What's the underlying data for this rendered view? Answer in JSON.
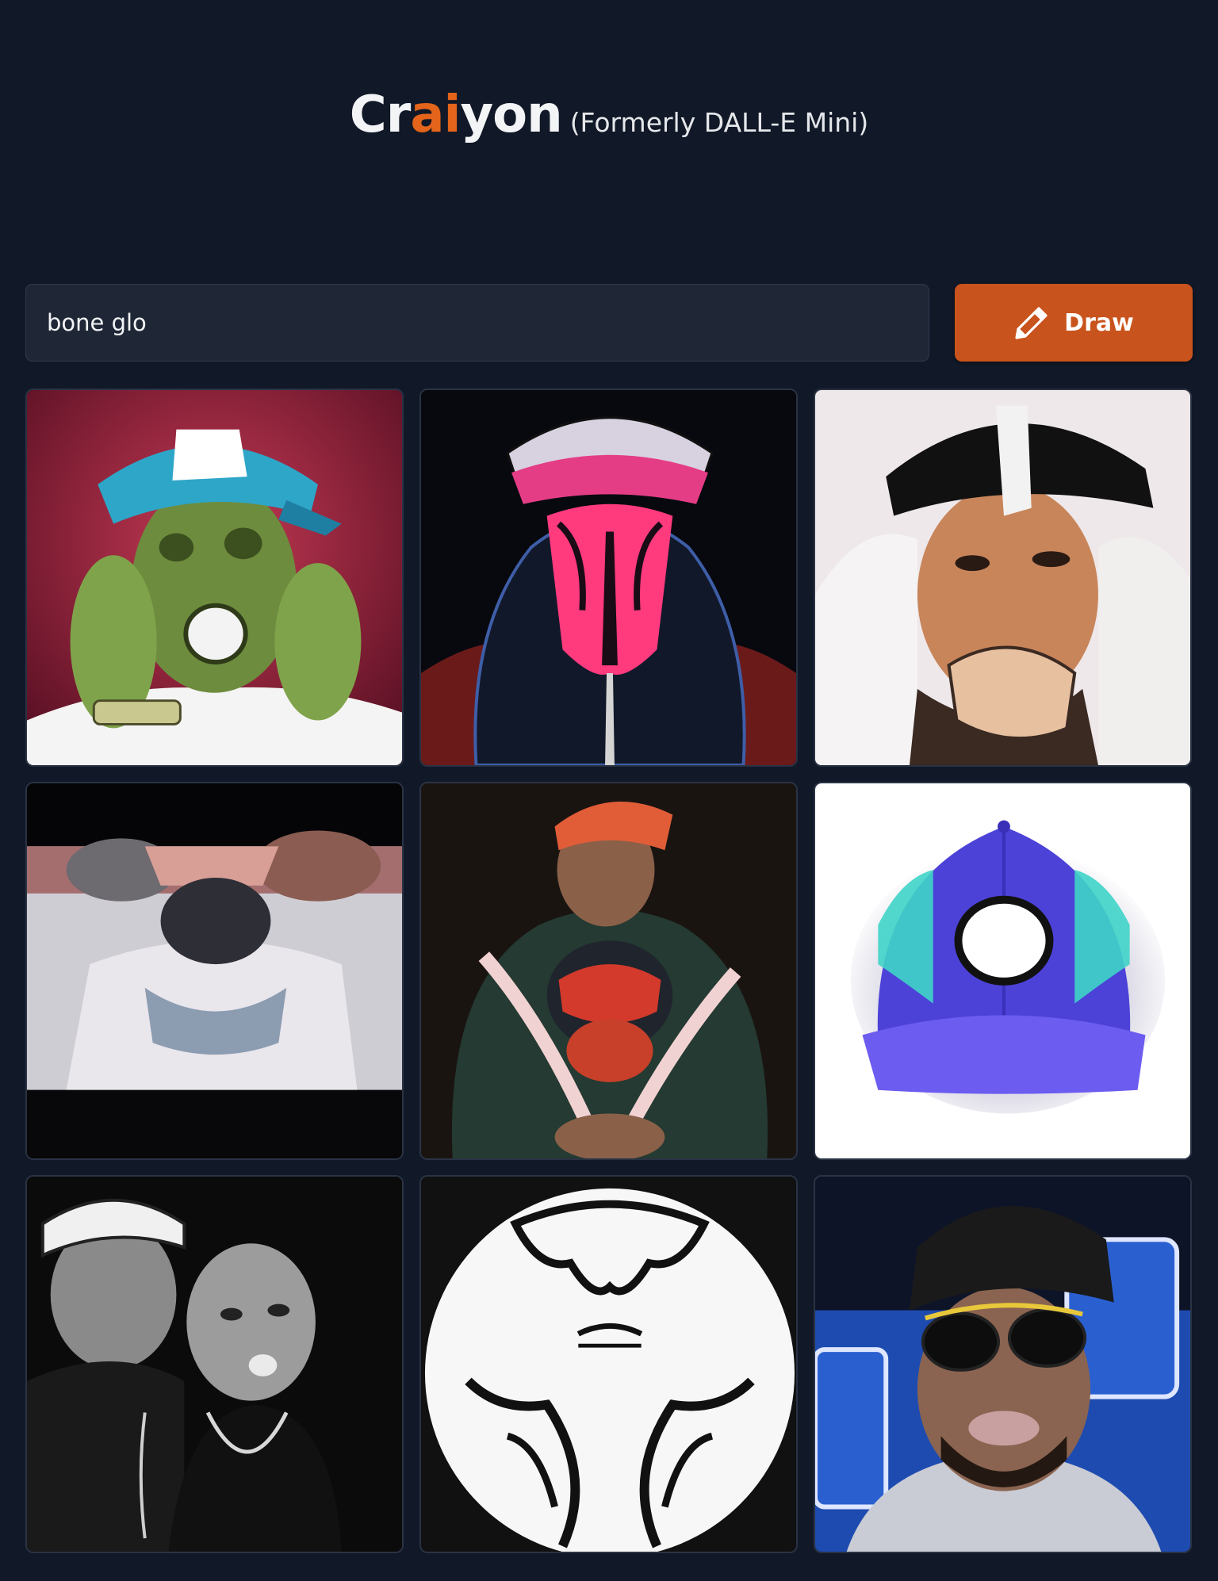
{
  "header": {
    "brand_part1": "Cr",
    "brand_accent": "ai",
    "brand_part2": "yon",
    "subtitle": "(Formerly DALL-E Mini)"
  },
  "search": {
    "value": "bone glo"
  },
  "draw_button": {
    "label": "Draw",
    "icon": "pencil-icon"
  },
  "colors": {
    "background": "#111827",
    "accent": "#e3641a",
    "button": "#c9531c",
    "input_background": "#1f2737"
  },
  "results": [
    {
      "index": 1,
      "description": "man in light blue cap with hands on cheeks, red background"
    },
    {
      "index": 2,
      "description": "hooded figure with pink cap and pink face"
    },
    {
      "index": 3,
      "description": "man in black cap with hand at mouth, white background"
    },
    {
      "index": 4,
      "description": "person in white t-shirt with face hidden by cap"
    },
    {
      "index": 5,
      "description": "crouching person in dark green hoodie and orange cap"
    },
    {
      "index": 6,
      "description": "blue baseball cap on white background"
    },
    {
      "index": 7,
      "description": "black and white photo of two men"
    },
    {
      "index": 8,
      "description": "black and white circular logo illustration"
    },
    {
      "index": 9,
      "description": "man in black sunglasses and grey hoodie"
    }
  ]
}
